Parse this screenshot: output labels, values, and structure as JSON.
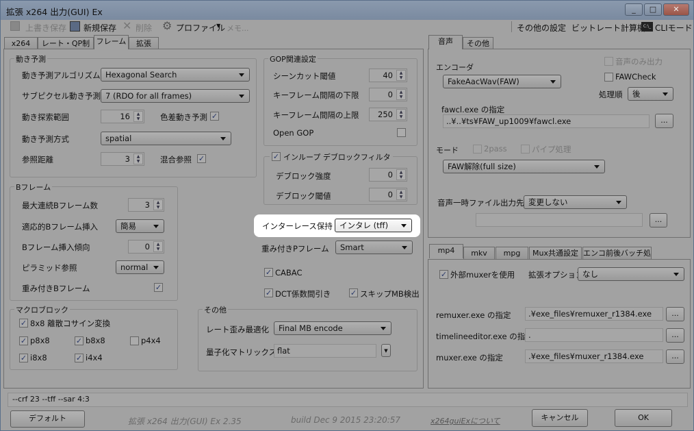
{
  "window": {
    "title": "拡張 x264 出力(GUI) Ex",
    "buttons": [
      "_",
      "□",
      "✕"
    ]
  },
  "toolbar": {
    "overwrite_save": "上書き保存",
    "new_save": "新規保存",
    "delete": "削除",
    "profile": "プロファイル",
    "memo": "メモ...",
    "other_settings": "その他の設定",
    "bitrate_calc": "ビットレート計算機",
    "cli_mode": "CLIモード",
    "cli_icon_text": "C:\\_"
  },
  "left_tabs": [
    "x264",
    "レート・QP制御",
    "フレーム",
    "拡張"
  ],
  "motion": {
    "title": "動き予測",
    "algo_label": "動き予測アルゴリズム",
    "algo": "Hexagonal Search",
    "subpel_label": "サブピクセル動き予測",
    "subpel": "7 (RDO for all frames)",
    "range_label": "動き探索範囲",
    "range": "16",
    "chroma_label": "色差動き予測",
    "mode_label": "動き予測方式",
    "mode": "spatial",
    "ref_label": "参照距離",
    "ref": "3",
    "mixed_label": "混合参照"
  },
  "bframe": {
    "title": "Bフレーム",
    "max_label": "最大連続Bフレーム数",
    "max": "3",
    "adaptive_label": "適応的Bフレーム挿入",
    "adaptive": "簡易",
    "bias_label": "Bフレーム挿入傾向",
    "bias": "0",
    "pyramid_label": "ピラミッド参照",
    "pyramid": "normal",
    "weighted_label": "重み付きBフレーム"
  },
  "macroblock": {
    "title": "マクロブロック",
    "dct8x8": "8x8 離散コサイン変換",
    "p8x8": "p8x8",
    "b8x8": "b8x8",
    "p4x4": "p4x4",
    "i8x8": "i8x8",
    "i4x4": "i4x4"
  },
  "gop": {
    "title": "GOP関連設定",
    "scenecut_label": "シーンカット閾値",
    "scenecut": "40",
    "keyint_min_label": "キーフレーム間隔の下限",
    "keyint_min": "0",
    "keyint_max_label": "キーフレーム間隔の上限",
    "keyint_max": "250",
    "open_gop": "Open GOP"
  },
  "deblock": {
    "title": "インループ デブロックフィルタ",
    "strength_label": "デブロック強度",
    "strength": "0",
    "threshold_label": "デブロック閾値",
    "threshold": "0"
  },
  "interlace": {
    "label": "インターレース保持",
    "value": "インタレ (tff)"
  },
  "weightp": {
    "label": "重み付きPフレーム",
    "value": "Smart"
  },
  "cabac": "CABAC",
  "dct_decimate": "DCT係数間引き",
  "fast_pskip": "スキップMB検出",
  "other": {
    "title": "その他",
    "trellis_label": "レート歪み最適化",
    "trellis": "Final MB encode",
    "cqm_label": "量子化マトリックス",
    "cqm": "flat"
  },
  "audio_tabs": [
    "音声",
    "その他"
  ],
  "audio": {
    "encoder_label": "エンコーダ",
    "encoder": "FakeAacWav(FAW)",
    "audio_only": "音声のみ出力",
    "faw_check": "FAWCheck",
    "order_label": "処理順",
    "order": "後",
    "exe_label": "fawcl.exe の指定",
    "exe_path": "..¥..¥ts¥FAW_up1009¥fawcl.exe",
    "browse": "...",
    "mode_label": "モード",
    "twopass": "2pass",
    "pipe": "パイプ処理",
    "mode": "FAW解除(full size)",
    "temp_label": "音声一時ファイル出力先",
    "temp": "変更しない",
    "temp_path": ""
  },
  "mux_tabs": [
    "mp4",
    "mkv",
    "mpg",
    "Mux共通設定",
    "エンコ前後バッチ処理"
  ],
  "mux": {
    "use_external": "外部muxerを使用",
    "ext_label": "拡張オプション",
    "ext": "なし",
    "remuxer_label": "remuxer.exe の指定",
    "remuxer": ".¥exe_files¥remuxer_r1384.exe",
    "timeline_label": "timelineeditor.exe の指定",
    "timeline": ".¥exe_files¥timelineeditor_r1384.exe",
    "muxer_label": "muxer.exe の指定",
    "muxer": ".¥exe_files¥muxer_r1384.exe"
  },
  "cmdline": "--crf 23 --tff --sar 4:3",
  "footer": {
    "default": "デフォルト",
    "version": "拡張 x264 出力(GUI) Ex 2.35",
    "build": "build Dec  9 2015 23:20:57",
    "about": "x264guiExについて",
    "cancel": "キャンセル",
    "ok": "OK"
  },
  "check_mark": "✓"
}
